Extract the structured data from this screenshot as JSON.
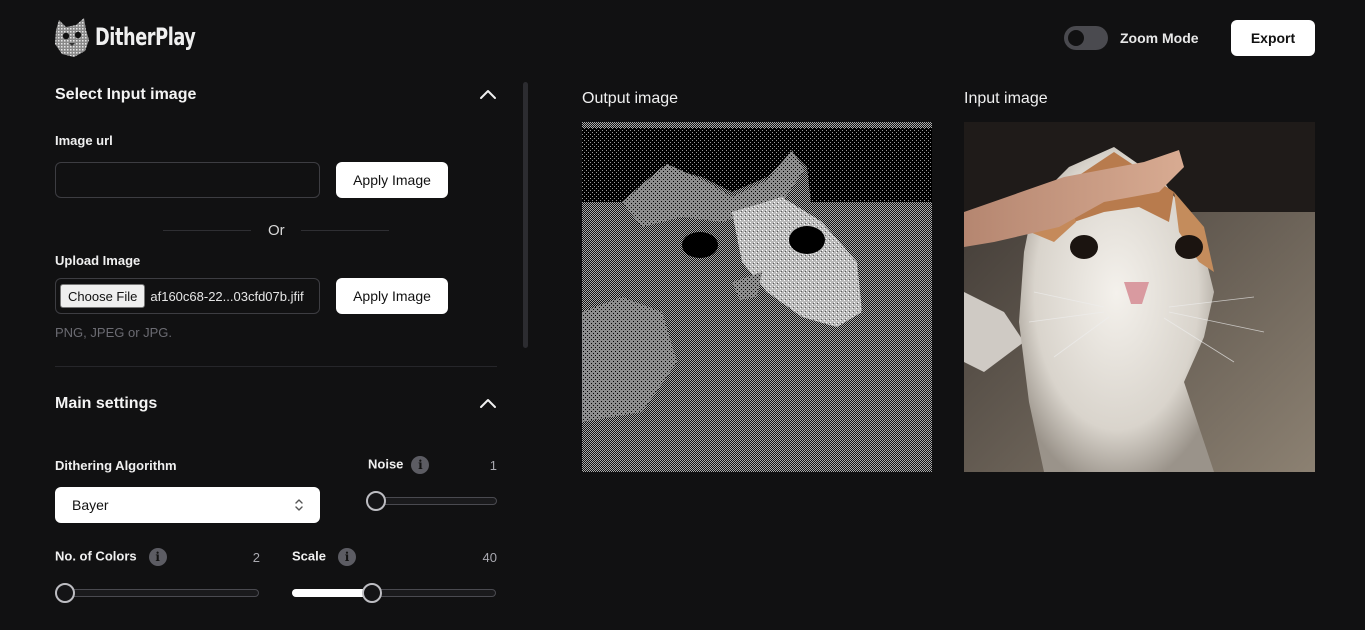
{
  "app": {
    "name": "DitherPlay",
    "zoom_mode_label": "Zoom Mode",
    "zoom_mode_on": false,
    "export_label": "Export"
  },
  "input_section": {
    "title": "Select Input image",
    "image_url_label": "Image url",
    "image_url_value": "",
    "apply_image_label": "Apply Image",
    "or_text": "Or",
    "upload_label": "Upload Image",
    "choose_file_label": "Choose File",
    "file_name": "af160c68-22...03cfd07b.jfif",
    "upload_apply_label": "Apply Image",
    "formats_hint": "PNG, JPEG or JPG."
  },
  "main_settings": {
    "title": "Main settings",
    "algorithm_label": "Dithering Algorithm",
    "algorithm_value": "Bayer",
    "noise_label": "Noise",
    "noise_value": "1",
    "noise_fraction": 0,
    "colors_label": "No. of Colors",
    "colors_value": "2",
    "colors_fraction": 0,
    "scale_label": "Scale",
    "scale_value": "40",
    "scale_fraction": 0.38
  },
  "panels": {
    "output_label": "Output image",
    "input_label": "Input image"
  },
  "colors": {
    "background": "#111112",
    "button_bg": "#ffffff",
    "muted_text": "#6b6b72"
  }
}
